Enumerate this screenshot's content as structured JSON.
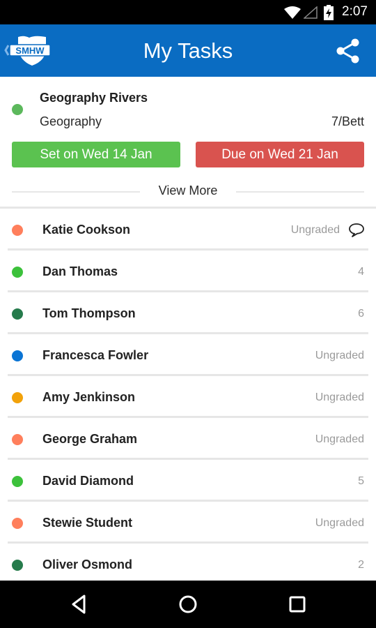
{
  "status_bar": {
    "time": "2:07",
    "icons": [
      "wifi-icon",
      "cell-signal-icon",
      "battery-charging-icon"
    ]
  },
  "app_bar": {
    "title": "My Tasks",
    "logo_text": "SMHW",
    "back_icon": "chevron-left-icon",
    "share_icon": "share-icon",
    "color": "#0a6cc2"
  },
  "task": {
    "title": "Geography Rivers",
    "subject": "Geography",
    "class": "7/Bett",
    "status_color": "#5cb85c",
    "set_label": "Set on Wed 14 Jan",
    "set_color": "#5bc250",
    "due_label": "Due on Wed 21 Jan",
    "due_color": "#d9534f",
    "view_more_label": "View More"
  },
  "students": [
    {
      "name": "Katie Cookson",
      "grade": "Ungraded",
      "color": "#ff7f5c",
      "has_comment": true
    },
    {
      "name": "Dan Thomas",
      "grade": "4",
      "color": "#3cc13b",
      "has_comment": false
    },
    {
      "name": "Tom Thompson",
      "grade": "6",
      "color": "#267b4c",
      "has_comment": false
    },
    {
      "name": "Francesca Fowler",
      "grade": "Ungraded",
      "color": "#0a74d4",
      "has_comment": false
    },
    {
      "name": "Amy Jenkinson",
      "grade": "Ungraded",
      "color": "#f2a20a",
      "has_comment": false
    },
    {
      "name": "George Graham",
      "grade": "Ungraded",
      "color": "#ff7f5c",
      "has_comment": false
    },
    {
      "name": "David Diamond",
      "grade": "5",
      "color": "#3cc13b",
      "has_comment": false
    },
    {
      "name": "Stewie Student",
      "grade": "Ungraded",
      "color": "#ff7f5c",
      "has_comment": false
    },
    {
      "name": "Oliver Osmond",
      "grade": "2",
      "color": "#267b4c",
      "has_comment": false
    }
  ],
  "nav_bar": {
    "buttons": [
      "back-icon",
      "home-icon",
      "recent-apps-icon"
    ]
  }
}
